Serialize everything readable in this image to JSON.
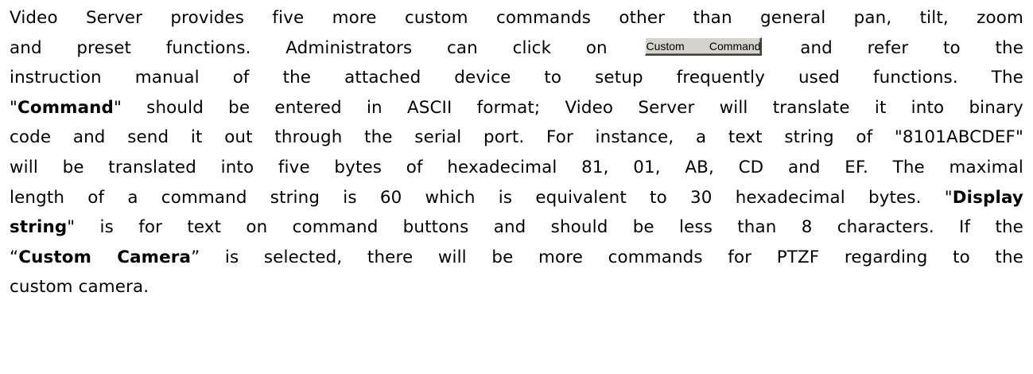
{
  "paragraph": {
    "l1": "Video Server provides five more custom commands other than general pan, tilt, zoom",
    "l2_pre": "and preset functions. Administrators can click on",
    "custom_command_button": "Custom Command",
    "l2_post": "and refer to the",
    "l3": "instruction manual of the attached device to setup frequently used functions. The",
    "l4_q1": "\"",
    "l4_bold": "Command",
    "l4_rest": "\" should be entered in ASCII format; Video Server will translate it into binary",
    "l5": "code and send it out through the serial port. For instance, a text string of \"8101ABCDEF\"",
    "l6": "will be translated into five bytes of hexadecimal 81, 01, AB, CD and EF. The maximal",
    "l7_pre": "length of a command string is 60 which is equivalent to 30 hexadecimal bytes. \"",
    "l7_bold": "Display",
    "l8_bold": "string",
    "l8_rest": "\" is for text on command buttons and should be less than 8 characters. If the",
    "l9_q1": "“",
    "l9_bold": "Custom Camera",
    "l9_rest": "” is selected, there will be more commands for PTZF regarding to the",
    "l10": "custom camera."
  }
}
